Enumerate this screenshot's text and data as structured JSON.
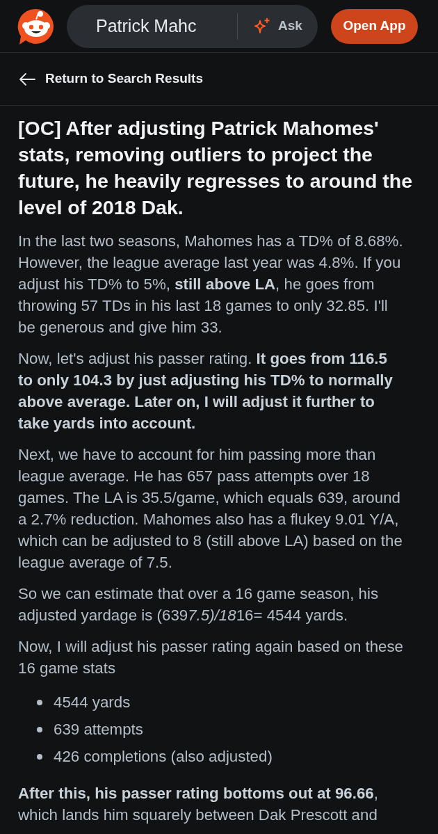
{
  "header": {
    "search": {
      "value": "Patrick Mahc"
    },
    "ask_button": "Ask",
    "open_app_button": "Open App"
  },
  "back_link": "Return to Search Results",
  "post": {
    "title": "[OC] After adjusting Patrick Mahomes' stats, removing outliers to project the future, he heavily regresses to around the level of 2018 Dak.",
    "body": [
      {
        "kind": "paragraph",
        "text": "In the last two seasons, Mahomes has a TD% of 8.68%. However, the league average last year was 4.8%. If you adjust his TD% to 5%, **still above LA**, he goes from throwing 57 TDs in his last 18 games to only 32.85. I'll be generous and give him 33."
      },
      {
        "kind": "paragraph",
        "text": "Now, let's adjust his passer rating. **It goes from 116.5 to only 104.3 by just adjusting his TD% to normally above average. Later on, I will adjust it further to take yards into account.**"
      },
      {
        "kind": "paragraph",
        "text": "Next, we have to account for him passing more than league average. He has 657 pass attempts over 18 games. The LA is 35.5/game, which equals 639, around a 2.7% reduction. Mahomes also has a flukey 9.01 Y/A, which can be adjusted to 8 (still above LA) based on the league average of 7.5."
      },
      {
        "kind": "paragraph",
        "runs": [
          {
            "text": "So we can estimate that over a 16 game season, his adjusted yardage is (639",
            "italic": false
          },
          {
            "text": "7.5)/18",
            "italic": true
          },
          {
            "text": "16= 4544 yards.",
            "italic": false
          }
        ]
      },
      {
        "kind": "paragraph",
        "text": "Now, I will adjust his passer rating again based on these 16 game stats"
      },
      {
        "kind": "list",
        "items": [
          "4544 yards",
          "639 attempts",
          "426 completions (also adjusted)"
        ]
      },
      {
        "kind": "paragraph",
        "text": "**After this, his passer rating bottoms out at 96.66**, which lands him squarely between Dak Prescott and"
      }
    ]
  }
}
